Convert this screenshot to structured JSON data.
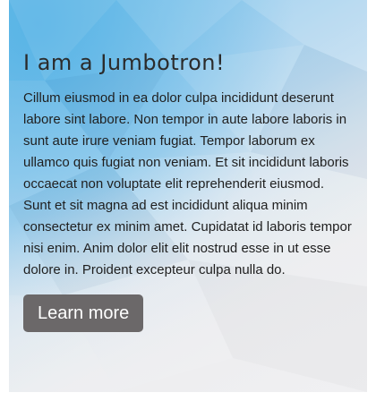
{
  "jumbotron": {
    "title": "I am a Jumbotron!",
    "text": "Cillum eiusmod in ea dolor culpa incididunt deserunt labore sint labore. Non tempor in aute labore laboris in sunt aute irure veniam fugiat. Tempor laborum ex ullamco quis fugiat non veniam. Et sit incididunt laboris occaecat non voluptate elit reprehenderit eiusmod. Sunt et sit magna ad est incididunt aliqua minim consectetur ex minim amet. Cupidatat id laboris tempor nisi enim. Anim dolor elit elit nostrud esse in ut esse dolore in. Proident excepteur culpa nulla do.",
    "button_label": "Learn more"
  },
  "colors": {
    "background_start": "#58b4e6",
    "background_end": "#ededef",
    "button_bg": "#6b6869",
    "button_text": "#ffffff",
    "text": "#1f1f1f"
  }
}
